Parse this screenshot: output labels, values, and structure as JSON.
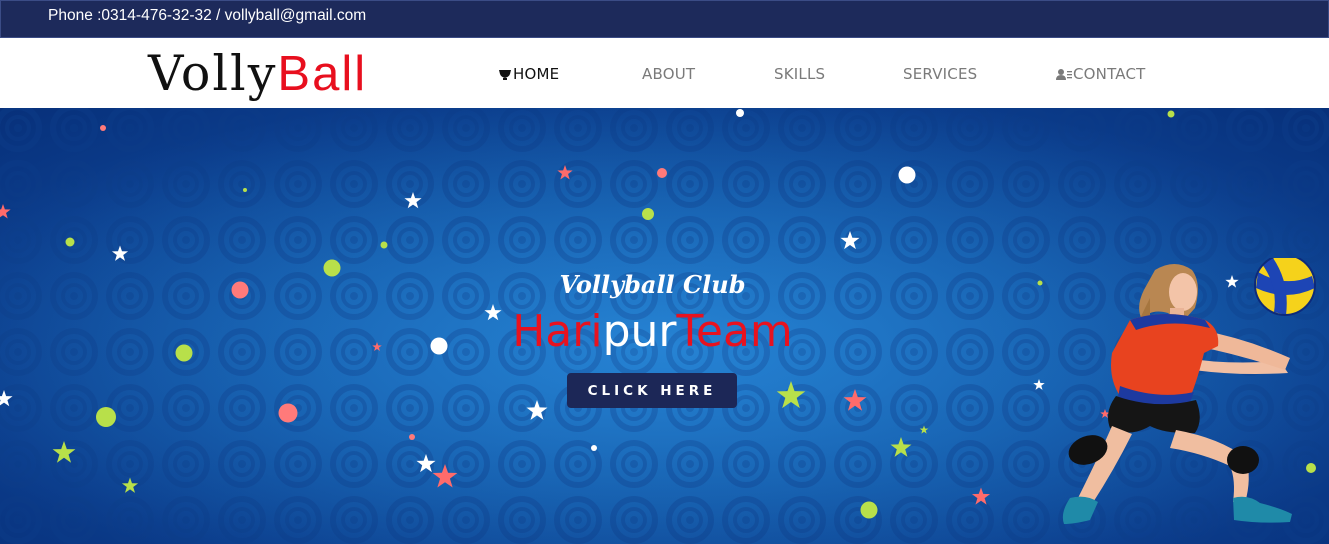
{
  "topbar": {
    "contact_text": "Phone :0314-476-32-32 / vollyball@gmail.com"
  },
  "logo": {
    "part1": "Volly",
    "part2": "Ball",
    "colors": {
      "part1": "#111111",
      "part2": "#e80f1e"
    }
  },
  "nav": {
    "items": [
      {
        "label": "HOME",
        "icon": "home-icon",
        "active": true
      },
      {
        "label": "ABOUT",
        "active": false
      },
      {
        "label": "SKILLS",
        "active": false
      },
      {
        "label": "SERVICES",
        "active": false
      },
      {
        "label": "CONTACT",
        "icon": "user-list-icon",
        "active": false
      }
    ]
  },
  "hero": {
    "subtitle": "Vollyball Club",
    "headline_parts": [
      "Hari",
      "pur",
      "Team"
    ],
    "headline_colors": [
      "#e8121f",
      "#ffffff",
      "#e8121f"
    ],
    "cta_label": "CLICK HERE"
  },
  "colors": {
    "topbar": "#1d2a5b",
    "hero_blue": "#135aa9",
    "button": "#1c2757",
    "confetti": [
      "#ffffff",
      "#ff6b6b",
      "#b8e04a"
    ]
  }
}
